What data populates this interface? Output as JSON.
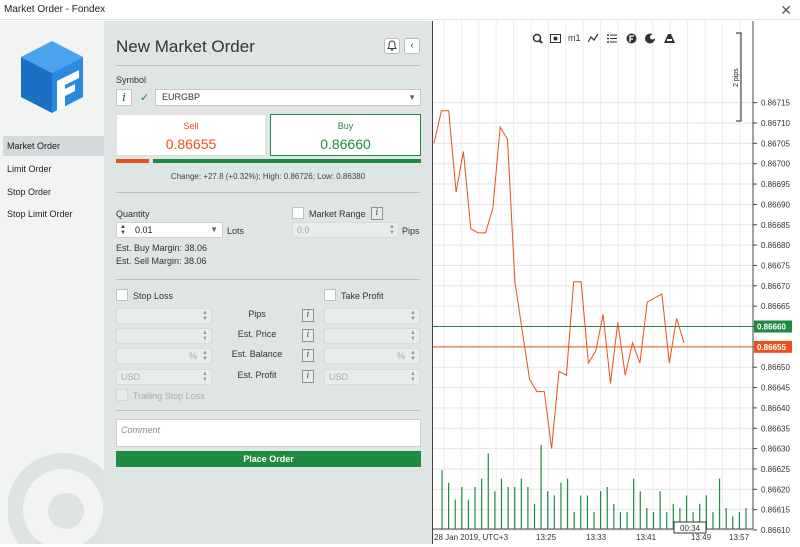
{
  "window": {
    "title": "Market Order - Fondex",
    "close": "✕"
  },
  "sidebar": {
    "items": [
      {
        "label": "Market Order",
        "active": true
      },
      {
        "label": "Limit Order"
      },
      {
        "label": "Stop Order"
      },
      {
        "label": "Stop Limit Order"
      }
    ]
  },
  "order": {
    "title": "New Market Order",
    "symbol_label": "Symbol",
    "symbol_value": "EURGBP",
    "sell_label": "Sell",
    "sell_price": "0.86655",
    "buy_label": "Buy",
    "buy_price": "0.86660",
    "change_text": "Change: +27.8 (+0.32%); High: 0.86726; Low: 0.86380",
    "quantity_label": "Quantity",
    "quantity_value": "0.01",
    "lots_label": "Lots",
    "buy_margin": "Est. Buy Margin: 38.06",
    "sell_margin": "Est. Sell Margin: 38.06",
    "market_range_label": "Market Range",
    "market_range_value": "0.0",
    "pips_label": "Pips",
    "stop_loss_label": "Stop Loss",
    "take_profit_label": "Take Profit",
    "row_labels": [
      "Pips",
      "Est. Price",
      "Est. Balance",
      "Est. Profit"
    ],
    "percent": "%",
    "currency": "USD",
    "trailing_label": "Trailing Stop Loss",
    "comment_placeholder": "Comment",
    "place_label": "Place Order"
  },
  "chart_data": {
    "type": "line",
    "symbol": "EURGBP",
    "x_tick_labels": [
      "28 Jan 2019, UTC+3",
      "13:25",
      "13:33",
      "13:41",
      "13:49",
      "13:57"
    ],
    "y_tick_labels": [
      "0.86715",
      "0.86710",
      "0.86705",
      "0.86700",
      "0.86695",
      "0.86690",
      "0.86685",
      "0.86680",
      "0.86675",
      "0.86670",
      "0.86665",
      "0.86660",
      "0.86655",
      "0.86650",
      "0.86645",
      "0.86640",
      "0.86635",
      "0.86630",
      "0.86625",
      "0.86620",
      "0.86615",
      "0.86610"
    ],
    "ylim": [
      0.86605,
      0.86718
    ],
    "bid_line": {
      "value": 0.86655,
      "label": "0.86655",
      "color": "#e8501c"
    },
    "ask_line": {
      "value": 0.8666,
      "label": "0.86660",
      "color": "#1f8a42"
    },
    "series": [
      {
        "color": "#e8501c",
        "values": [
          0.86705,
          0.86713,
          0.86713,
          0.86693,
          0.86703,
          0.86684,
          0.86683,
          0.86683,
          0.86689,
          0.86709,
          0.86706,
          0.86671,
          0.86659,
          0.86647,
          0.86644,
          0.86644,
          0.8663,
          0.86649,
          0.86648,
          0.86671,
          0.86671,
          0.86651,
          0.86654,
          0.86663,
          0.86646,
          0.86661,
          0.86648,
          0.86656,
          0.86651,
          0.86666,
          0.86667,
          0.86668,
          0.86651,
          0.86662,
          0.86656
        ]
      }
    ],
    "volume": [
      14,
      11,
      7,
      10,
      7,
      10,
      12,
      18,
      9,
      12,
      10,
      10,
      12,
      10,
      6,
      20,
      9,
      8,
      11,
      12,
      4,
      8,
      8,
      4,
      9,
      10,
      6,
      4,
      4,
      12,
      9,
      5,
      4,
      9,
      4,
      6,
      5,
      8,
      4,
      6,
      8,
      4,
      12,
      5,
      3,
      4,
      5
    ],
    "volume_color": "#1f8a42",
    "crosshair_time": "00:34",
    "scale_label": "2 pips",
    "toolbar_icons": [
      "zoom-icon",
      "screenshot-icon",
      "timeframe-m1-icon",
      "line-chart-icon",
      "indicators-icon",
      "fondex-icon",
      "color-theme-icon",
      "draw-icon"
    ],
    "timeframe": "m1"
  }
}
